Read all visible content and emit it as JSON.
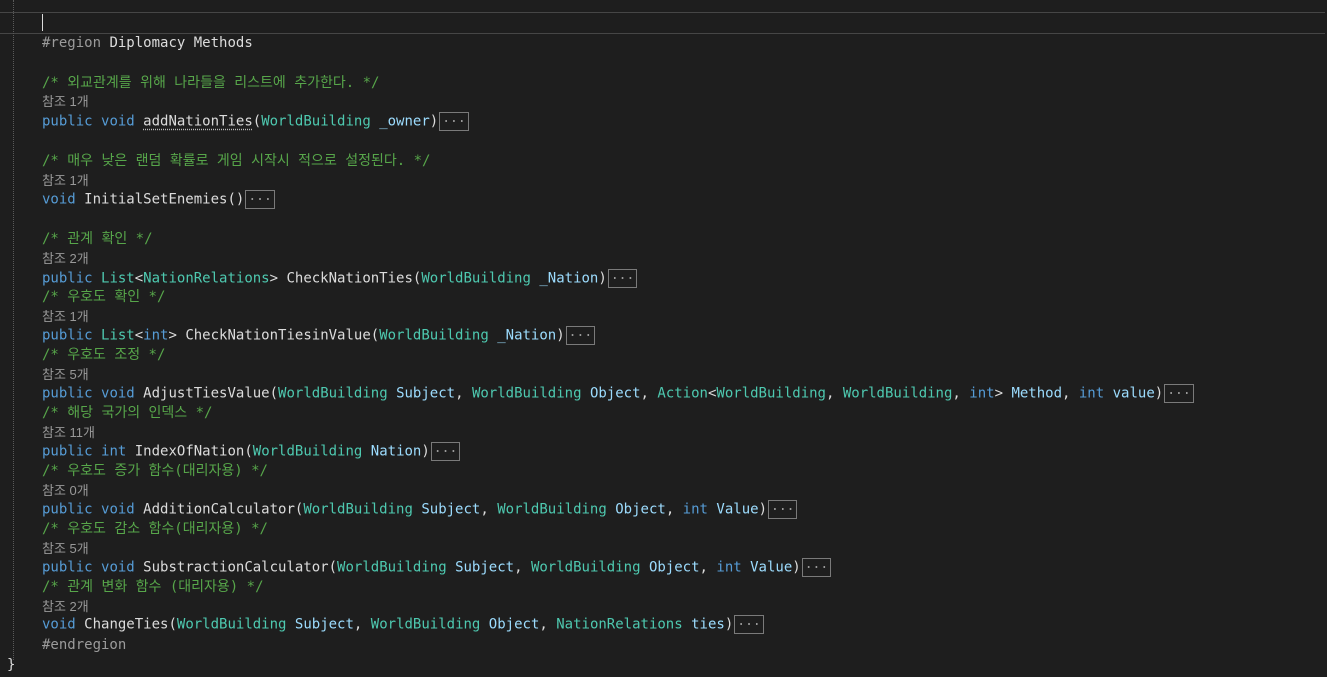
{
  "region_start": "#region",
  "region_name": "Diplomacy Methods",
  "region_end": "#endregion",
  "closing_brace": "}",
  "fold_marker": "...",
  "comments": [
    "/* 외교관계를 위해 나라들을 리스트에 추가한다. */",
    "/* 매우 낮은 랜덤 확률로 게임 시작시 적으로 설정된다. */",
    "/* 관계 확인 */",
    "/* 우호도 확인 */",
    "/* 우호도 조정 */",
    "/* 해당 국가의 인덱스 */",
    "/* 우호도 증가 함수(대리자용) */",
    "/* 우호도 감소 함수(대리자용) */",
    "/* 관계 변화 함수 (대리자용) */"
  ],
  "references": [
    "참조 1개",
    "참조 1개",
    "참조 2개",
    "참조 1개",
    "참조 5개",
    "참조 11개",
    "참조 0개",
    "참조 5개",
    "참조 2개"
  ],
  "methods": [
    {
      "tokens": [
        {
          "t": "public",
          "c": "kw"
        },
        {
          "t": " "
        },
        {
          "t": "void",
          "c": "kw"
        },
        {
          "t": " "
        },
        {
          "t": "addNationTies",
          "c": "id squiggle"
        },
        {
          "t": "("
        },
        {
          "t": "WorldBuilding",
          "c": "ty"
        },
        {
          "t": " "
        },
        {
          "t": "_owner",
          "c": "pm"
        },
        {
          "t": ")"
        }
      ]
    },
    {
      "tokens": [
        {
          "t": "void",
          "c": "kw"
        },
        {
          "t": " "
        },
        {
          "t": "InitialSetEnemies",
          "c": "id"
        },
        {
          "t": "()"
        }
      ]
    },
    {
      "tokens": [
        {
          "t": "public",
          "c": "kw"
        },
        {
          "t": " "
        },
        {
          "t": "List",
          "c": "ty"
        },
        {
          "t": "<"
        },
        {
          "t": "NationRelations",
          "c": "ty"
        },
        {
          "t": "> "
        },
        {
          "t": "CheckNationTies",
          "c": "id"
        },
        {
          "t": "("
        },
        {
          "t": "WorldBuilding",
          "c": "ty"
        },
        {
          "t": " "
        },
        {
          "t": "_Nation",
          "c": "pm"
        },
        {
          "t": ")"
        }
      ]
    },
    {
      "tokens": [
        {
          "t": "public",
          "c": "kw"
        },
        {
          "t": " "
        },
        {
          "t": "List",
          "c": "ty"
        },
        {
          "t": "<"
        },
        {
          "t": "int",
          "c": "kw"
        },
        {
          "t": "> "
        },
        {
          "t": "CheckNationTiesinValue",
          "c": "id"
        },
        {
          "t": "("
        },
        {
          "t": "WorldBuilding",
          "c": "ty"
        },
        {
          "t": " "
        },
        {
          "t": "_Nation",
          "c": "pm"
        },
        {
          "t": ")"
        }
      ]
    },
    {
      "tokens": [
        {
          "t": "public",
          "c": "kw"
        },
        {
          "t": " "
        },
        {
          "t": "void",
          "c": "kw"
        },
        {
          "t": " "
        },
        {
          "t": "AdjustTiesValue",
          "c": "id"
        },
        {
          "t": "("
        },
        {
          "t": "WorldBuilding",
          "c": "ty"
        },
        {
          "t": " "
        },
        {
          "t": "Subject",
          "c": "pm"
        },
        {
          "t": ", "
        },
        {
          "t": "WorldBuilding",
          "c": "ty"
        },
        {
          "t": " "
        },
        {
          "t": "Object",
          "c": "pm"
        },
        {
          "t": ", "
        },
        {
          "t": "Action",
          "c": "ty"
        },
        {
          "t": "<"
        },
        {
          "t": "WorldBuilding",
          "c": "ty"
        },
        {
          "t": ", "
        },
        {
          "t": "WorldBuilding",
          "c": "ty"
        },
        {
          "t": ", "
        },
        {
          "t": "int",
          "c": "kw"
        },
        {
          "t": "> "
        },
        {
          "t": "Method",
          "c": "pm"
        },
        {
          "t": ", "
        },
        {
          "t": "int",
          "c": "kw"
        },
        {
          "t": " "
        },
        {
          "t": "value",
          "c": "pm"
        },
        {
          "t": ")"
        }
      ]
    },
    {
      "tokens": [
        {
          "t": "public",
          "c": "kw"
        },
        {
          "t": " "
        },
        {
          "t": "int",
          "c": "kw"
        },
        {
          "t": " "
        },
        {
          "t": "IndexOfNation",
          "c": "id"
        },
        {
          "t": "("
        },
        {
          "t": "WorldBuilding",
          "c": "ty"
        },
        {
          "t": " "
        },
        {
          "t": "Nation",
          "c": "pm"
        },
        {
          "t": ")"
        }
      ]
    },
    {
      "tokens": [
        {
          "t": "public",
          "c": "kw"
        },
        {
          "t": " "
        },
        {
          "t": "void",
          "c": "kw"
        },
        {
          "t": " "
        },
        {
          "t": "AdditionCalculator",
          "c": "id"
        },
        {
          "t": "("
        },
        {
          "t": "WorldBuilding",
          "c": "ty"
        },
        {
          "t": " "
        },
        {
          "t": "Subject",
          "c": "pm"
        },
        {
          "t": ", "
        },
        {
          "t": "WorldBuilding",
          "c": "ty"
        },
        {
          "t": " "
        },
        {
          "t": "Object",
          "c": "pm"
        },
        {
          "t": ", "
        },
        {
          "t": "int",
          "c": "kw"
        },
        {
          "t": " "
        },
        {
          "t": "Value",
          "c": "pm"
        },
        {
          "t": ")"
        }
      ]
    },
    {
      "tokens": [
        {
          "t": "public",
          "c": "kw"
        },
        {
          "t": " "
        },
        {
          "t": "void",
          "c": "kw"
        },
        {
          "t": " "
        },
        {
          "t": "SubstractionCalculator",
          "c": "id"
        },
        {
          "t": "("
        },
        {
          "t": "WorldBuilding",
          "c": "ty"
        },
        {
          "t": " "
        },
        {
          "t": "Subject",
          "c": "pm"
        },
        {
          "t": ", "
        },
        {
          "t": "WorldBuilding",
          "c": "ty"
        },
        {
          "t": " "
        },
        {
          "t": "Object",
          "c": "pm"
        },
        {
          "t": ", "
        },
        {
          "t": "int",
          "c": "kw"
        },
        {
          "t": " "
        },
        {
          "t": "Value",
          "c": "pm"
        },
        {
          "t": ")"
        }
      ]
    },
    {
      "tokens": [
        {
          "t": "void",
          "c": "kw"
        },
        {
          "t": " "
        },
        {
          "t": "ChangeTies",
          "c": "id"
        },
        {
          "t": "("
        },
        {
          "t": "WorldBuilding",
          "c": "ty"
        },
        {
          "t": " "
        },
        {
          "t": "Subject",
          "c": "pm"
        },
        {
          "t": ", "
        },
        {
          "t": "WorldBuilding",
          "c": "ty"
        },
        {
          "t": " "
        },
        {
          "t": "Object",
          "c": "pm"
        },
        {
          "t": ", "
        },
        {
          "t": "NationRelations",
          "c": "ty"
        },
        {
          "t": " "
        },
        {
          "t": "ties",
          "c": "pm"
        },
        {
          "t": ")"
        }
      ]
    }
  ]
}
